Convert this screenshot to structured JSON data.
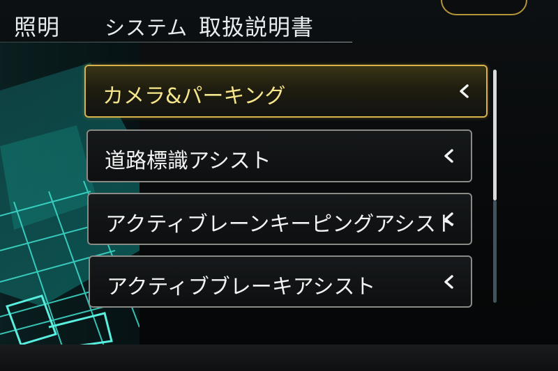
{
  "tabs": [
    {
      "label": "照明"
    },
    {
      "label": "システム"
    },
    {
      "label": "取扱説明書"
    }
  ],
  "menu": {
    "items": [
      {
        "label": "カメラ&パーキング",
        "selected": true
      },
      {
        "label": "道路標識アシスト",
        "selected": false
      },
      {
        "label": "アクティブレーンキーピングアシスト",
        "selected": false
      },
      {
        "label": "アクティブブレーキアシスト",
        "selected": false
      }
    ]
  },
  "scrollbar": {
    "visible_fraction": 0.56
  },
  "colors": {
    "selected_accent": "#d9b24a",
    "selected_text": "#f5e68c",
    "viz_teal": "#3fe0d0"
  },
  "icons": {
    "item_chevron": "chevron-left-icon",
    "car_view": "car-grid-visualization"
  }
}
